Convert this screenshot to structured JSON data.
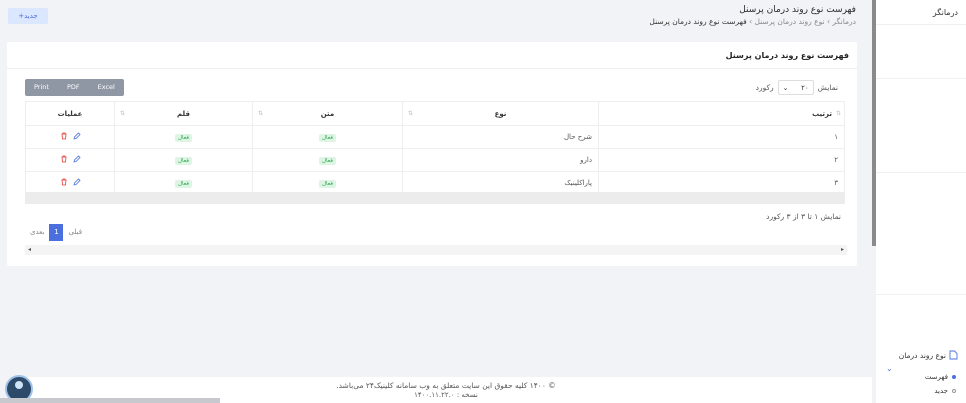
{
  "toolbar": {
    "new_label": "+جدید"
  },
  "header": {
    "title": "فهرست نوع روند درمان پرسنل",
    "breadcrumb": [
      "درمانگر",
      "نوع روند درمان پرسنل",
      "فهرست نوع روند درمان پرسنل"
    ]
  },
  "card": {
    "title": "فهرست نوع روند درمان پرسنل"
  },
  "export": [
    "Print",
    "PDF",
    "Excel"
  ],
  "length": {
    "prefix": "نمایش",
    "value": "۲۰",
    "suffix": "رکورد"
  },
  "table": {
    "headers": [
      "ترتیب",
      "نوع",
      "متن",
      "قلم",
      "عملیات"
    ],
    "rows": [
      {
        "order": "۱",
        "type": "شرح حال",
        "text_status": "فعال",
        "pen_status": "فعال"
      },
      {
        "order": "۲",
        "type": "دارو",
        "text_status": "فعال",
        "pen_status": "فعال"
      },
      {
        "order": "۳",
        "type": "پاراکلینیک",
        "text_status": "فعال",
        "pen_status": "فعال"
      }
    ]
  },
  "info": "نمایش ۱ تا ۳ از ۳ رکورد",
  "pager": {
    "prev": "قبلی",
    "page": "1",
    "next": "بعدی"
  },
  "footer": {
    "copyright": "© ۱۴۰۰ کلیه حقوق این سایت متعلق به وب سامانه کلینیک۲۴ می‌باشد.",
    "version": "نسخه : ۱۴۰۰.۱۱.۲۲.۰"
  },
  "sidebar": {
    "brand": "درمانگر",
    "group": "نوع روند درمان",
    "items": [
      "فهرست",
      "جدید"
    ]
  },
  "colors": {
    "accent": "#4c6fe0",
    "active_badge": "#28a745",
    "delete": "#e53935"
  }
}
